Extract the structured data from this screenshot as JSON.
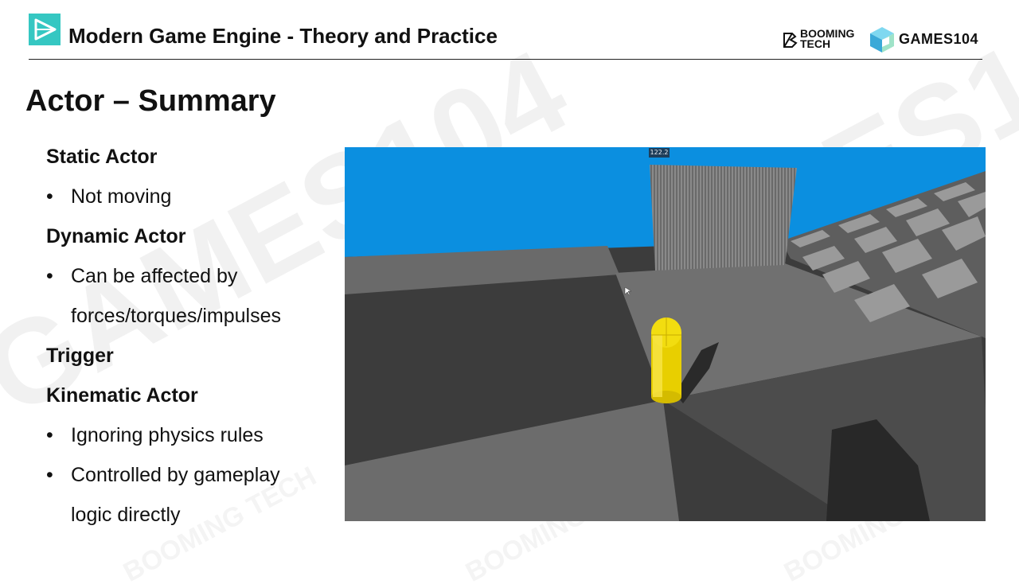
{
  "header": {
    "course_title": "Modern Game Engine - Theory and Practice",
    "booming_tech": "BOOMING\nTECH",
    "games104": "GAMES104"
  },
  "slide": {
    "title": "Actor – Summary",
    "items": [
      {
        "kind": "heading",
        "text": "Static Actor"
      },
      {
        "kind": "bullet",
        "text": "Not moving"
      },
      {
        "kind": "heading",
        "text": "Dynamic Actor"
      },
      {
        "kind": "bullet",
        "text": "Can be affected by"
      },
      {
        "kind": "cont",
        "text": "forces/torques/impulses"
      },
      {
        "kind": "heading",
        "text": "Trigger"
      },
      {
        "kind": "heading",
        "text": "Kinematic Actor"
      },
      {
        "kind": "bullet",
        "text": "Ignoring physics rules"
      },
      {
        "kind": "bullet",
        "text": "Controlled by gameplay"
      },
      {
        "kind": "cont",
        "text": "logic directly"
      }
    ],
    "bullet_glyph": "•"
  },
  "scene": {
    "fps_label": "122.2",
    "colors": {
      "sky": "#0b8fe0",
      "floor_dark": "#3a3a3a",
      "floor_light": "#6e6e6e",
      "capsule": "#f2dd10"
    }
  },
  "watermark": {
    "text": "GAMES104",
    "logo_text": "BOOMING TECH"
  }
}
